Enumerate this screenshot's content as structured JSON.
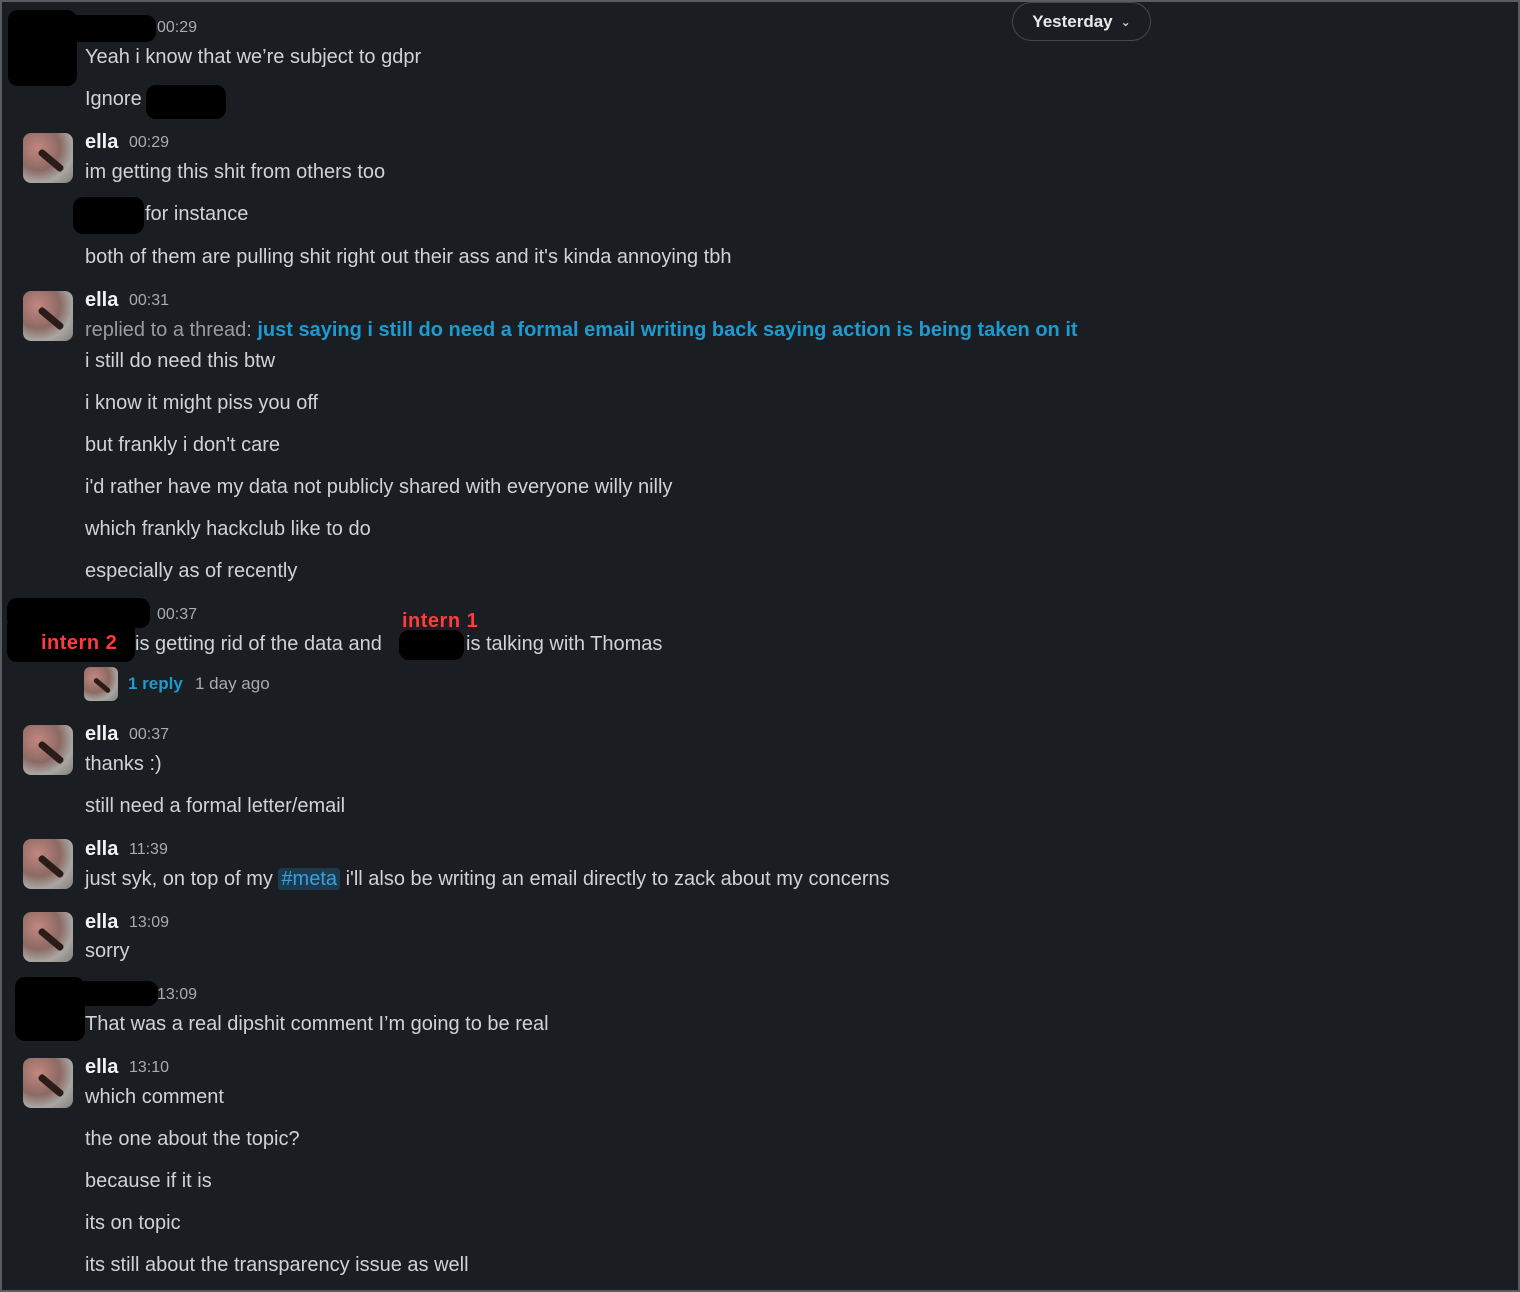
{
  "date_divider": {
    "label": "Yesterday",
    "icon": "chevron-down-icon"
  },
  "m1": {
    "time": "00:29",
    "lines": [
      "Yeah i know that we’re subject to gdpr",
      "Ignore"
    ]
  },
  "m2": {
    "author": "ella",
    "time": "00:29",
    "lines": [
      "im getting this shit from others too",
      "for instance",
      "both of them are pulling shit right out their ass and it's kinda annoying tbh"
    ]
  },
  "m3": {
    "author": "ella",
    "time": "00:31",
    "thread_prefix": "replied to a thread:",
    "thread_link": "just saying i still do need a formal email writing back saying action is being taken on it",
    "lines": [
      "i still do need this btw",
      "i know it might piss you off",
      "but frankly i don't care",
      "i'd rather have my data not publicly shared with everyone willy nilly",
      "which frankly hackclub like to do",
      "especially as of recently"
    ]
  },
  "m4": {
    "time": "00:37",
    "annotation_intern1": "intern 1",
    "annotation_intern2": "intern 2",
    "part1": "is getting rid of the data and",
    "part2": "is talking with Thomas",
    "reply_count": "1 reply",
    "reply_time": "1 day ago"
  },
  "m5": {
    "author": "ella",
    "time": "00:37",
    "lines": [
      "thanks :)",
      "still need a formal letter/email"
    ]
  },
  "m6": {
    "author": "ella",
    "time": "11:39",
    "pre": "just syk, on top of my",
    "channel": "#meta",
    "post": "i'll also be writing an email directly to zack about my concerns"
  },
  "m7": {
    "author": "ella",
    "time": "13:09",
    "lines": [
      "sorry"
    ]
  },
  "m8": {
    "time": "13:09",
    "lines": [
      "That was a real dipshit comment I’m going to be real"
    ]
  },
  "m9": {
    "author": "ella",
    "time": "13:10",
    "lines": [
      "which comment",
      "the one about the topic?",
      "because if it is",
      "its on topic",
      "its still about the transparency issue as well"
    ]
  }
}
